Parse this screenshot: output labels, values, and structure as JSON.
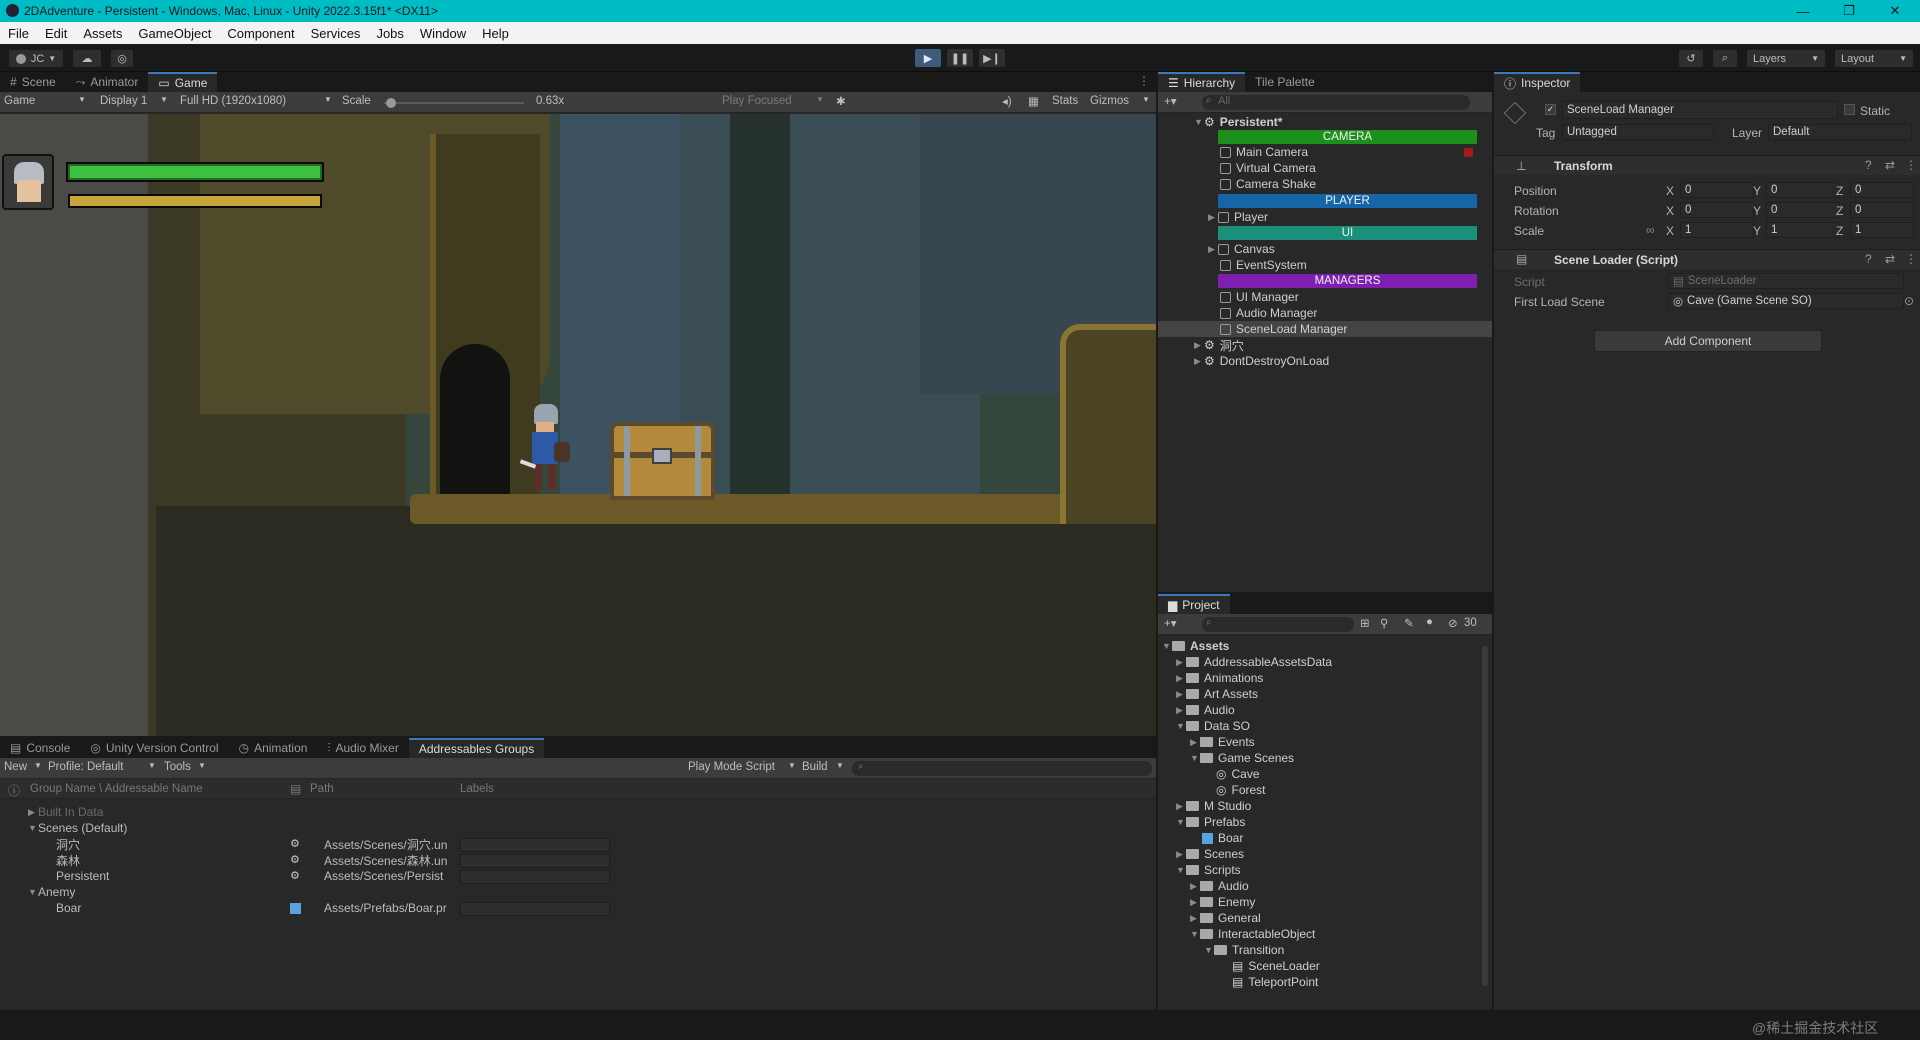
{
  "window": {
    "title": "2DAdventure - Persistent - Windows, Mac, Linux - Unity 2022.3.15f1* <DX11>",
    "controls": [
      "—",
      "❐",
      "✕"
    ]
  },
  "menu": [
    "File",
    "Edit",
    "Assets",
    "GameObject",
    "Component",
    "Services",
    "Jobs",
    "Window",
    "Help"
  ],
  "toolbar": {
    "account": "JC",
    "layers": "Layers",
    "layout": "Layout"
  },
  "scene_tabs": [
    "Scene",
    "Animator",
    "Game"
  ],
  "game_bar": {
    "mode": "Game",
    "display": "Display 1",
    "resolution": "Full HD (1920x1080)",
    "scale_label": "Scale",
    "scale_value": "0.63x",
    "play_focused": "Play Focused",
    "stats": "Stats",
    "gizmos": "Gizmos"
  },
  "hud": {
    "health_fraction": 1.0,
    "energy_fraction": 1.0
  },
  "hierarchy": {
    "tabs": [
      "Hierarchy",
      "Tile Palette"
    ],
    "search_placeholder": "All",
    "root": "Persistent*",
    "banners": [
      {
        "label": "CAMERA",
        "color": "#1c8f1c"
      },
      {
        "label": "PLAYER",
        "color": "#1565a8"
      },
      {
        "label": "UI",
        "color": "#1a8f7a"
      },
      {
        "label": "MANAGERS",
        "color": "#7e1fb0"
      }
    ],
    "items": {
      "main_camera": "Main Camera",
      "virtual_camera": "Virtual Camera",
      "camera_shake": "Camera Shake",
      "player": "Player",
      "canvas": "Canvas",
      "event_system": "EventSystem",
      "ui_manager": "UI Manager",
      "audio_manager": "Audio Manager",
      "sceneload_manager": "SceneLoad Manager",
      "cave_scene": "洞穴",
      "dont_destroy": "DontDestroyOnLoad"
    }
  },
  "inspector": {
    "tab": "Inspector",
    "object_name": "SceneLoad Manager",
    "static": "Static",
    "tag_label": "Tag",
    "tag_value": "Untagged",
    "layer_label": "Layer",
    "layer_value": "Default",
    "transform": {
      "title": "Transform",
      "position_label": "Position",
      "rotation_label": "Rotation",
      "scale_label": "Scale",
      "position": {
        "x": "0",
        "y": "0",
        "z": "0"
      },
      "rotation": {
        "x": "0",
        "y": "0",
        "z": "0"
      },
      "scale": {
        "x": "1",
        "y": "1",
        "z": "1"
      },
      "axis_x": "X",
      "axis_y": "Y",
      "axis_z": "Z"
    },
    "scene_loader": {
      "title": "Scene Loader (Script)",
      "script_label": "Script",
      "script_value": "SceneLoader",
      "first_load_label": "First Load Scene",
      "first_load_value": "Cave (Game Scene SO)"
    },
    "add_component": "Add Component"
  },
  "project": {
    "tab": "Project",
    "hidden_count": "30",
    "tree": {
      "assets": "Assets",
      "addressable": "AddressableAssetsData",
      "animations": "Animations",
      "art": "Art Assets",
      "audio": "Audio",
      "dataso": "Data SO",
      "events": "Events",
      "gamescenes": "Game Scenes",
      "cave": "Cave",
      "forest": "Forest",
      "mstudio": "M Studio",
      "prefabs": "Prefabs",
      "boar": "Boar",
      "scenes": "Scenes",
      "scripts": "Scripts",
      "s_audio": "Audio",
      "s_enemy": "Enemy",
      "s_general": "General",
      "interactable": "InteractableObject",
      "transition": "Transition",
      "sceneloader": "SceneLoader",
      "teleport": "TeleportPoint"
    }
  },
  "bottom": {
    "tabs": [
      "Console",
      "Unity Version Control",
      "Animation",
      "Audio Mixer",
      "Addressables Groups"
    ],
    "bar": {
      "new": "New",
      "profile": "Profile: Default",
      "tools": "Tools",
      "play_mode": "Play Mode Script",
      "build": "Build"
    },
    "columns": {
      "name": "Group Name \\ Addressable Name",
      "path": "Path",
      "labels": "Labels"
    },
    "groups": {
      "builtin": "Built In Data",
      "scenes_default": "Scenes (Default)",
      "anemy": "Anemy"
    },
    "rows": [
      {
        "name": "洞穴",
        "path": "Assets/Scenes/洞穴.un"
      },
      {
        "name": "森林",
        "path": "Assets/Scenes/森林.un"
      },
      {
        "name": "Persistent",
        "path": "Assets/Scenes/Persist"
      },
      {
        "name": "Boar",
        "path": "Assets/Prefabs/Boar.pr"
      }
    ]
  },
  "watermark": "@稀土掘金技术社区"
}
